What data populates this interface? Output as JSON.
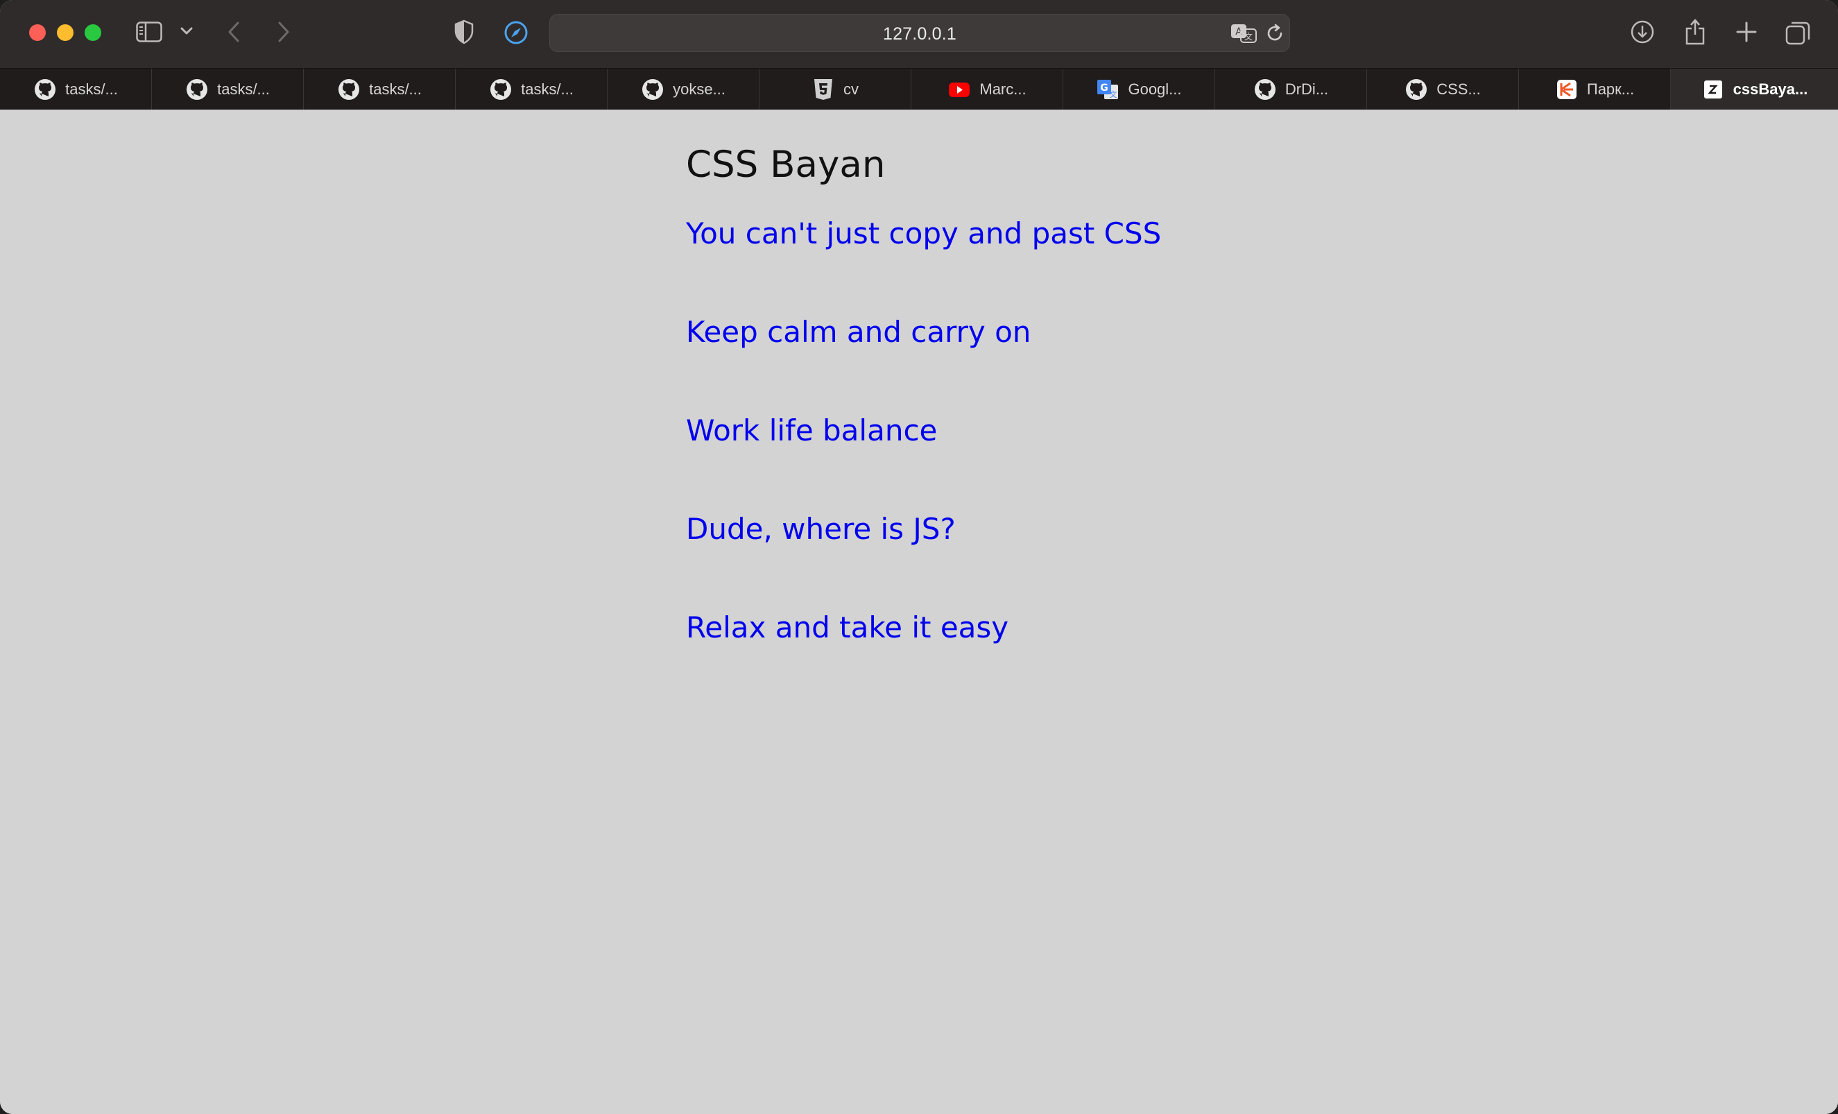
{
  "browser": {
    "address": "127.0.0.1",
    "tabs": [
      {
        "label": "tasks/...",
        "icon": "github-icon"
      },
      {
        "label": "tasks/...",
        "icon": "github-icon"
      },
      {
        "label": "tasks/...",
        "icon": "github-icon"
      },
      {
        "label": "tasks/...",
        "icon": "github-icon"
      },
      {
        "label": "yokse...",
        "icon": "github-icon"
      },
      {
        "label": "cv",
        "icon": "html5-icon"
      },
      {
        "label": "Marc...",
        "icon": "youtube-icon"
      },
      {
        "label": "Googl...",
        "icon": "google-translate-icon"
      },
      {
        "label": "DrDi...",
        "icon": "github-icon"
      },
      {
        "label": "CSS...",
        "icon": "github-icon"
      },
      {
        "label": "Парк...",
        "icon": "kite-icon"
      },
      {
        "label": "cssBaya...",
        "icon": "site-icon",
        "active": true
      }
    ]
  },
  "page": {
    "title": "CSS Bayan",
    "links": [
      "You can't just copy and past CSS",
      "Keep calm and carry on",
      "Work life balance",
      "Dude, where is JS?",
      "Relax and take it easy"
    ]
  },
  "colors": {
    "link": "#0000ee",
    "background": "#d3d3d3",
    "toolbar": "#2f2b2a"
  }
}
